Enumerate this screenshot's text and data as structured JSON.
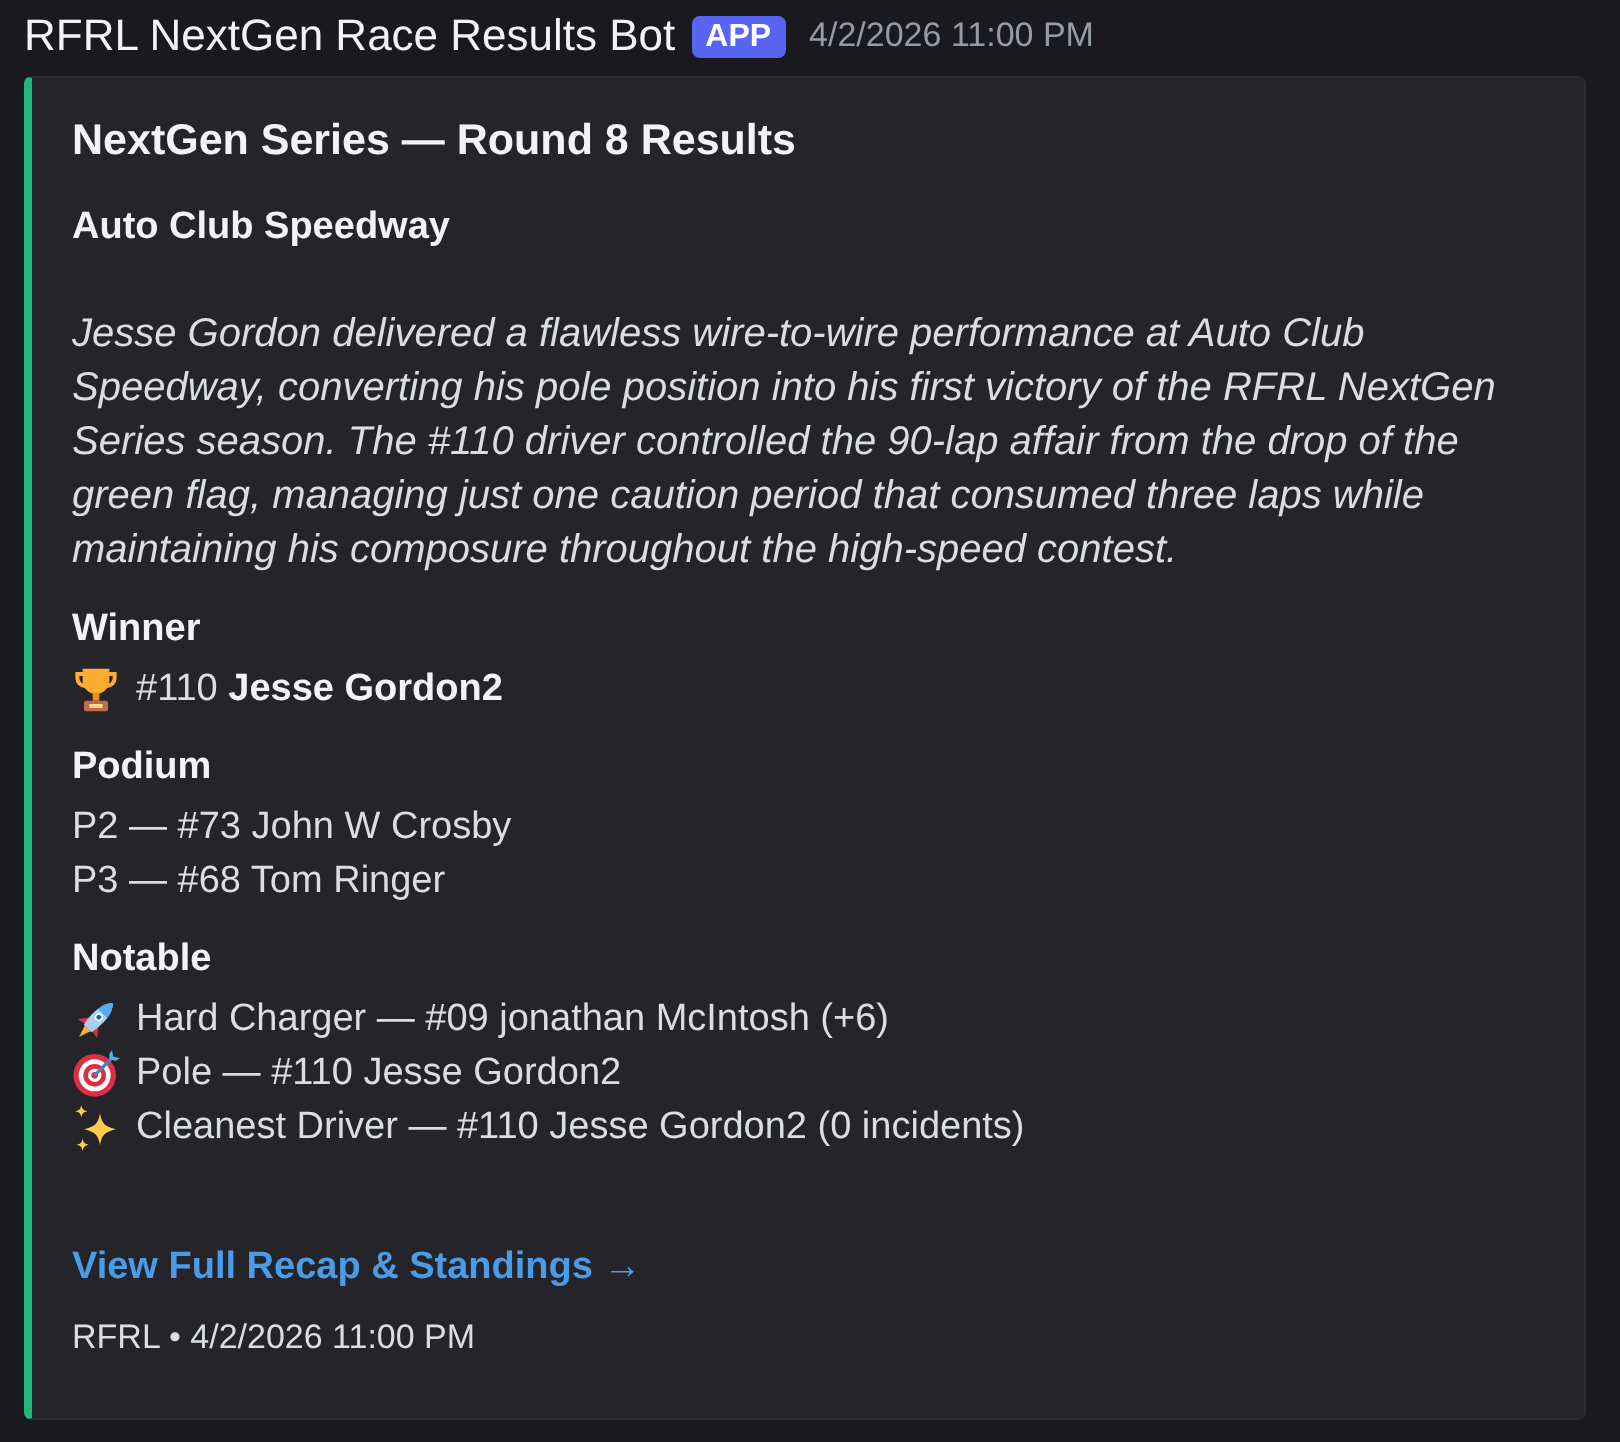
{
  "message": {
    "author": "RFRL NextGen Race Results Bot",
    "badge": "APP",
    "timestamp": "4/2/2026 11:00 PM"
  },
  "embed": {
    "title": "NextGen Series — Round 8 Results",
    "subtitle": "Auto Club Speedway",
    "description": "Jesse Gordon delivered a flawless wire-to-wire performance at Auto Club Speedway, converting his pole position into his first victory of the RFRL NextGen Series season. The #110 driver controlled the 90-lap affair from the drop of the green flag, managing just one caution period that consumed three laps while maintaining his composure throughout the high-speed contest.",
    "fields": [
      {
        "name": "Winner",
        "lines": [
          {
            "kind": "trophy",
            "text": "#110 **Jesse Gordon2**"
          }
        ]
      },
      {
        "name": "Podium",
        "lines": [
          {
            "kind": "text",
            "text": "P2 — #73 John W Crosby"
          },
          {
            "kind": "text",
            "text": "P3 — #68 Tom Ringer"
          }
        ]
      },
      {
        "name": "Notable",
        "lines": [
          {
            "kind": "rocket",
            "text": "Hard Charger — #09 jonathan McIntosh (+6)"
          },
          {
            "kind": "target",
            "text": "Pole — #110 Jesse Gordon2"
          },
          {
            "kind": "sparkles",
            "text": "Cleanest Driver — #110 Jesse Gordon2 (0 incidents)"
          }
        ]
      }
    ],
    "link": "View Full Recap & Standings →",
    "footer": "RFRL • 4/2/2026 11:00 PM"
  }
}
